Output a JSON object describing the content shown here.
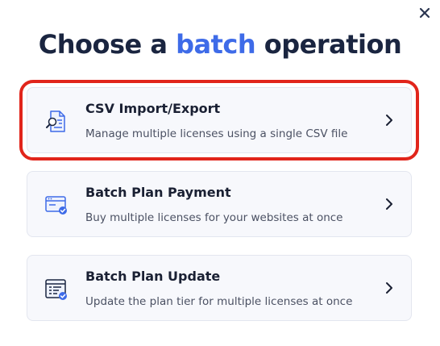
{
  "modal": {
    "title_prefix": "Choose a",
    "title_accent": "batch",
    "title_suffix": "operation",
    "accent_color": "#3e6be8",
    "close_icon": "close-icon"
  },
  "options": [
    {
      "title": "CSV Import/Export",
      "description": "Manage multiple licenses using a single CSV file",
      "icon": "csv-file-search-icon",
      "highlighted": true
    },
    {
      "title": "Batch Plan Payment",
      "description": "Buy multiple licenses for your websites at once",
      "icon": "browser-payment-icon",
      "highlighted": false
    },
    {
      "title": "Batch Plan Update",
      "description": "Update the plan tier for multiple licenses at once",
      "icon": "list-update-icon",
      "highlighted": false
    }
  ],
  "highlight_color": "#e1251b"
}
